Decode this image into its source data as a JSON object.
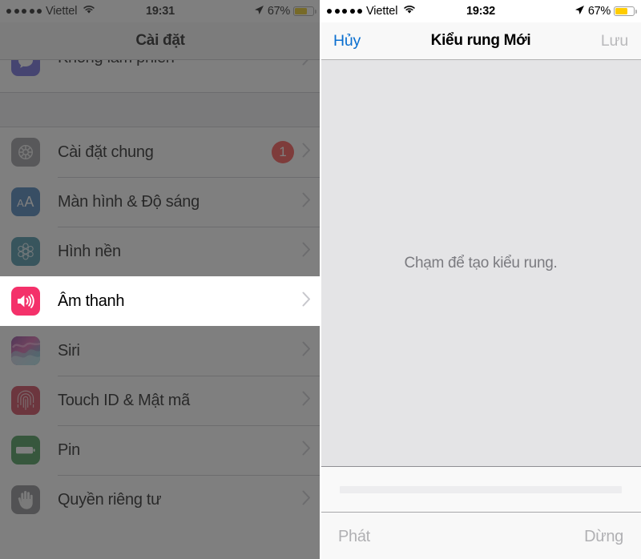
{
  "left_panel": {
    "status_bar": {
      "signal_dots": 5,
      "carrier": "Viettel",
      "wifi_icon": "wifi-icon",
      "time": "19:31",
      "location_icon": "location-arrow-icon",
      "battery_percent": "67%",
      "battery_level": 63,
      "battery_color": "#e6c200"
    },
    "nav": {
      "title": "Cài đặt"
    },
    "rows_top": [
      {
        "label": "Không làm phiền",
        "icon": "do-not-disturb-icon",
        "icon_bg": "#5856d6",
        "badge": null
      }
    ],
    "rows_middle": [
      {
        "label": "Cài đặt chung",
        "icon": "gear-icon",
        "icon_bg": "#8e8e93",
        "badge": "1"
      },
      {
        "label": "Màn hình & Độ sáng",
        "icon": "display-brightness-icon",
        "icon_bg": "#2f6fb0",
        "badge": null
      },
      {
        "label": "Hình nền",
        "icon": "wallpaper-icon",
        "icon_bg": "#31859c",
        "badge": null
      }
    ],
    "rows_highlight": [
      {
        "label": "Âm thanh",
        "icon": "speaker-volume-icon",
        "icon_bg": "#f4316a",
        "badge": null
      }
    ],
    "rows_bottom": [
      {
        "label": "Siri",
        "icon": "siri-icon",
        "icon_bg": "#6b3f7a",
        "badge": null
      },
      {
        "label": "Touch ID & Mật mã",
        "icon": "fingerprint-icon",
        "icon_bg": "#c62a41",
        "badge": null
      },
      {
        "label": "Pin",
        "icon": "battery-icon",
        "icon_bg": "#2d8a3e",
        "badge": null
      },
      {
        "label": "Quyền riêng tư",
        "icon": "hand-privacy-icon",
        "icon_bg": "#7d7d82",
        "badge": null
      }
    ],
    "chevron_icon": "chevron-right-icon",
    "dim_overlay": true
  },
  "right_panel": {
    "status_bar": {
      "signal_dots": 5,
      "carrier": "Viettel",
      "wifi_icon": "wifi-icon",
      "time": "19:32",
      "location_icon": "location-arrow-icon",
      "battery_percent": "67%",
      "battery_level": 63,
      "battery_color": "#ffcc00"
    },
    "nav": {
      "cancel_label": "Hủy",
      "title": "Kiểu rung Mới",
      "save_label": "Lưu"
    },
    "canvas": {
      "hint": "Chạm để tạo kiểu rung."
    },
    "track": {
      "progress": 0
    },
    "toolbar": {
      "play_label": "Phát",
      "stop_label": "Dừng"
    }
  }
}
